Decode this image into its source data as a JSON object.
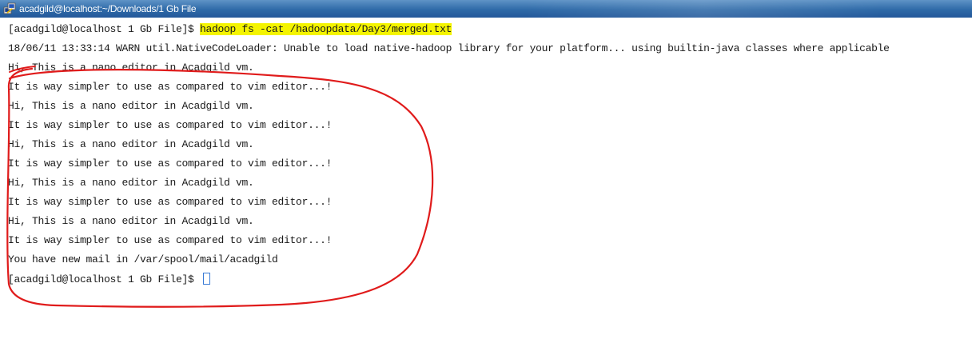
{
  "window": {
    "title": "acadgild@localhost:~/Downloads/1 Gb File",
    "icon": "putty-icon"
  },
  "terminal": {
    "prompt1": "[acadgild@localhost 1 Gb File]$ ",
    "command": "hadoop fs -cat /hadoopdata/Day3/merged.txt",
    "warn": "18/06/11 13:33:14 WARN util.NativeCodeLoader: Unable to load native-hadoop library for your platform... using builtin-java classes where applicable",
    "output": [
      "Hi, This is a nano editor in Acadgild vm.",
      "It is way simpler to use as compared to vim editor...!",
      "Hi, This is a nano editor in Acadgild vm.",
      "It is way simpler to use as compared to vim editor...!",
      "Hi, This is a nano editor in Acadgild vm.",
      "It is way simpler to use as compared to vim editor...!",
      "Hi, This is a nano editor in Acadgild vm.",
      "It is way simpler to use as compared to vim editor...!",
      "Hi, This is a nano editor in Acadgild vm.",
      "It is way simpler to use as compared to vim editor...!"
    ],
    "mail": "You have new mail in /var/spool/mail/acadgild",
    "prompt2": "[acadgild@localhost 1 Gb File]$ "
  },
  "colors": {
    "highlight": "#f4f400",
    "annotation": "#e01b1b",
    "titlebar": "#2f6aa8"
  }
}
